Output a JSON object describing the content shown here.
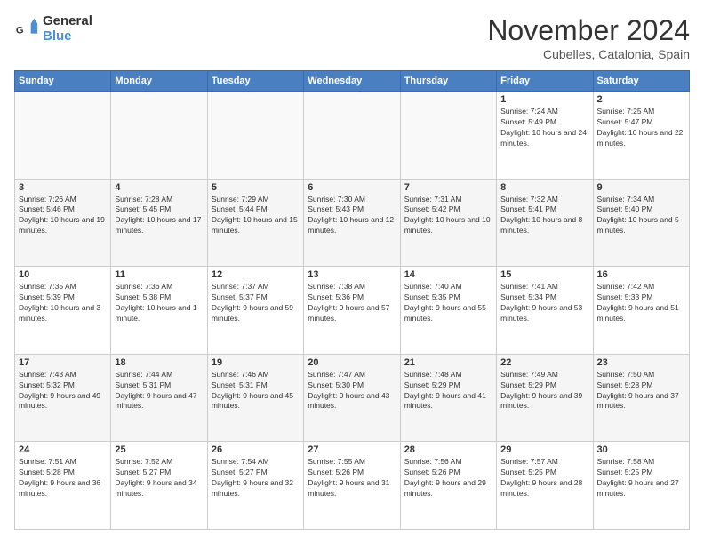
{
  "logo": {
    "general": "General",
    "blue": "Blue"
  },
  "header": {
    "month": "November 2024",
    "location": "Cubelles, Catalonia, Spain"
  },
  "weekdays": [
    "Sunday",
    "Monday",
    "Tuesday",
    "Wednesday",
    "Thursday",
    "Friday",
    "Saturday"
  ],
  "weeks": [
    [
      {
        "day": "",
        "info": ""
      },
      {
        "day": "",
        "info": ""
      },
      {
        "day": "",
        "info": ""
      },
      {
        "day": "",
        "info": ""
      },
      {
        "day": "",
        "info": ""
      },
      {
        "day": "1",
        "info": "Sunrise: 7:24 AM\nSunset: 5:49 PM\nDaylight: 10 hours and 24 minutes."
      },
      {
        "day": "2",
        "info": "Sunrise: 7:25 AM\nSunset: 5:47 PM\nDaylight: 10 hours and 22 minutes."
      }
    ],
    [
      {
        "day": "3",
        "info": "Sunrise: 7:26 AM\nSunset: 5:46 PM\nDaylight: 10 hours and 19 minutes."
      },
      {
        "day": "4",
        "info": "Sunrise: 7:28 AM\nSunset: 5:45 PM\nDaylight: 10 hours and 17 minutes."
      },
      {
        "day": "5",
        "info": "Sunrise: 7:29 AM\nSunset: 5:44 PM\nDaylight: 10 hours and 15 minutes."
      },
      {
        "day": "6",
        "info": "Sunrise: 7:30 AM\nSunset: 5:43 PM\nDaylight: 10 hours and 12 minutes."
      },
      {
        "day": "7",
        "info": "Sunrise: 7:31 AM\nSunset: 5:42 PM\nDaylight: 10 hours and 10 minutes."
      },
      {
        "day": "8",
        "info": "Sunrise: 7:32 AM\nSunset: 5:41 PM\nDaylight: 10 hours and 8 minutes."
      },
      {
        "day": "9",
        "info": "Sunrise: 7:34 AM\nSunset: 5:40 PM\nDaylight: 10 hours and 5 minutes."
      }
    ],
    [
      {
        "day": "10",
        "info": "Sunrise: 7:35 AM\nSunset: 5:39 PM\nDaylight: 10 hours and 3 minutes."
      },
      {
        "day": "11",
        "info": "Sunrise: 7:36 AM\nSunset: 5:38 PM\nDaylight: 10 hours and 1 minute."
      },
      {
        "day": "12",
        "info": "Sunrise: 7:37 AM\nSunset: 5:37 PM\nDaylight: 9 hours and 59 minutes."
      },
      {
        "day": "13",
        "info": "Sunrise: 7:38 AM\nSunset: 5:36 PM\nDaylight: 9 hours and 57 minutes."
      },
      {
        "day": "14",
        "info": "Sunrise: 7:40 AM\nSunset: 5:35 PM\nDaylight: 9 hours and 55 minutes."
      },
      {
        "day": "15",
        "info": "Sunrise: 7:41 AM\nSunset: 5:34 PM\nDaylight: 9 hours and 53 minutes."
      },
      {
        "day": "16",
        "info": "Sunrise: 7:42 AM\nSunset: 5:33 PM\nDaylight: 9 hours and 51 minutes."
      }
    ],
    [
      {
        "day": "17",
        "info": "Sunrise: 7:43 AM\nSunset: 5:32 PM\nDaylight: 9 hours and 49 minutes."
      },
      {
        "day": "18",
        "info": "Sunrise: 7:44 AM\nSunset: 5:31 PM\nDaylight: 9 hours and 47 minutes."
      },
      {
        "day": "19",
        "info": "Sunrise: 7:46 AM\nSunset: 5:31 PM\nDaylight: 9 hours and 45 minutes."
      },
      {
        "day": "20",
        "info": "Sunrise: 7:47 AM\nSunset: 5:30 PM\nDaylight: 9 hours and 43 minutes."
      },
      {
        "day": "21",
        "info": "Sunrise: 7:48 AM\nSunset: 5:29 PM\nDaylight: 9 hours and 41 minutes."
      },
      {
        "day": "22",
        "info": "Sunrise: 7:49 AM\nSunset: 5:29 PM\nDaylight: 9 hours and 39 minutes."
      },
      {
        "day": "23",
        "info": "Sunrise: 7:50 AM\nSunset: 5:28 PM\nDaylight: 9 hours and 37 minutes."
      }
    ],
    [
      {
        "day": "24",
        "info": "Sunrise: 7:51 AM\nSunset: 5:28 PM\nDaylight: 9 hours and 36 minutes."
      },
      {
        "day": "25",
        "info": "Sunrise: 7:52 AM\nSunset: 5:27 PM\nDaylight: 9 hours and 34 minutes."
      },
      {
        "day": "26",
        "info": "Sunrise: 7:54 AM\nSunset: 5:27 PM\nDaylight: 9 hours and 32 minutes."
      },
      {
        "day": "27",
        "info": "Sunrise: 7:55 AM\nSunset: 5:26 PM\nDaylight: 9 hours and 31 minutes."
      },
      {
        "day": "28",
        "info": "Sunrise: 7:56 AM\nSunset: 5:26 PM\nDaylight: 9 hours and 29 minutes."
      },
      {
        "day": "29",
        "info": "Sunrise: 7:57 AM\nSunset: 5:25 PM\nDaylight: 9 hours and 28 minutes."
      },
      {
        "day": "30",
        "info": "Sunrise: 7:58 AM\nSunset: 5:25 PM\nDaylight: 9 hours and 27 minutes."
      }
    ]
  ]
}
